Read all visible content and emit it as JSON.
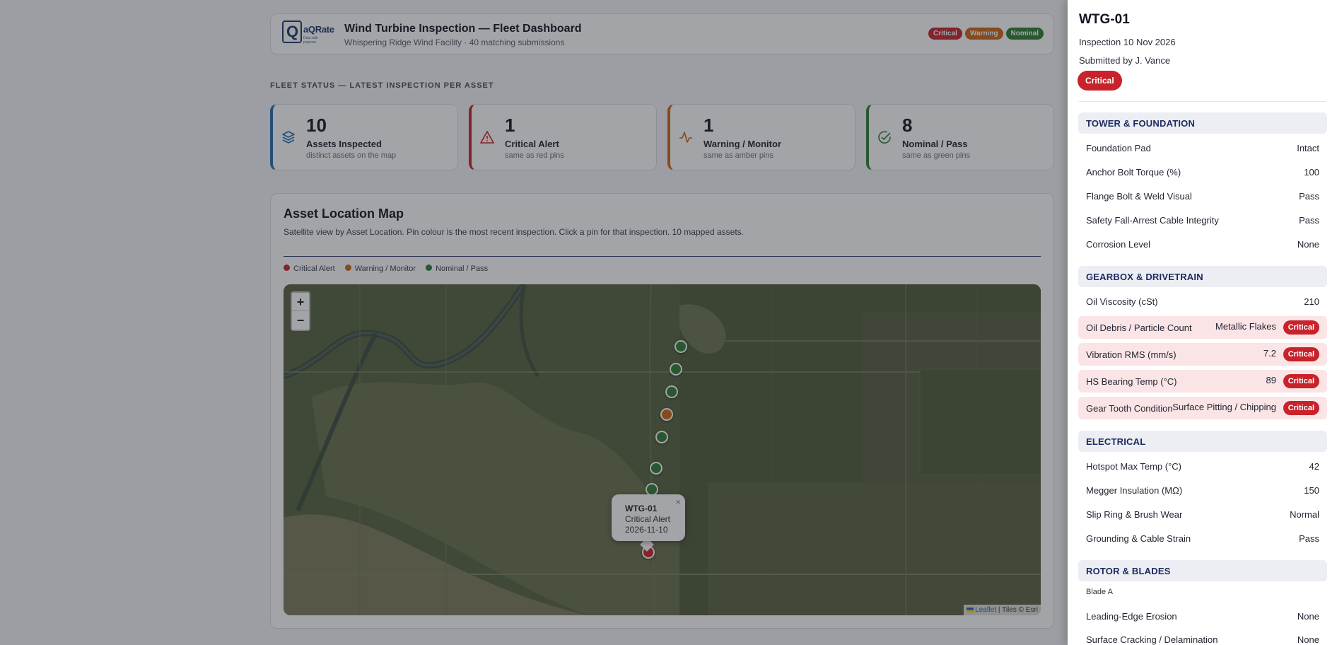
{
  "header": {
    "logo_text": "aQRate",
    "logo_q": "Q",
    "logo_tagline": "Data with purpose",
    "title": "Wind Turbine Inspection — Fleet Dashboard",
    "subtitle": "Whispering Ridge Wind Facility · 40 matching submissions",
    "pills": [
      {
        "label": "Critical",
        "color": "#c8222a"
      },
      {
        "label": "Warning",
        "color": "#cc6414"
      },
      {
        "label": "Nominal",
        "color": "#2e7d32"
      }
    ]
  },
  "section_label": "FLEET STATUS — LATEST INSPECTION PER ASSET",
  "kpis": [
    {
      "number": "10",
      "label": "Assets Inspected",
      "desc": "distinct assets on the map",
      "color": "#1f6fb2",
      "icon": "layers-icon"
    },
    {
      "number": "1",
      "label": "Critical Alert",
      "desc": "same as red pins",
      "color": "#c8222a",
      "icon": "alert-triangle-icon"
    },
    {
      "number": "1",
      "label": "Warning / Monitor",
      "desc": "same as amber pins",
      "color": "#cc6414",
      "icon": "activity-icon"
    },
    {
      "number": "8",
      "label": "Nominal / Pass",
      "desc": "same as green pins",
      "color": "#2e7d32",
      "icon": "check-circle-icon"
    }
  ],
  "map": {
    "title": "Asset Location Map",
    "description": "Satellite view by Asset Location. Pin colour is the most recent inspection. Click a pin for that inspection. 10 mapped assets.",
    "legend": [
      {
        "label": "Critical Alert",
        "color": "#c8222a"
      },
      {
        "label": "Warning / Monitor",
        "color": "#cc6414"
      },
      {
        "label": "Nominal / Pass",
        "color": "#2e7d32"
      }
    ],
    "zoom_in": "+",
    "zoom_out": "−",
    "popup": {
      "title": "WTG-01",
      "status": "Critical Alert",
      "date": "2026-11-10",
      "close": "×"
    },
    "attribution_link": "Leaflet",
    "attribution_rest": "| Tiles © Esri"
  },
  "drawer": {
    "title": "WTG-01",
    "inspection": "Inspection 10 Nov 2026",
    "submitted": "Submitted by J. Vance",
    "badge": "Critical",
    "critical_label": "Critical",
    "sections": {
      "tower": "TOWER & FOUNDATION",
      "gearbox": "GEARBOX & DRIVETRAIN",
      "electrical": "ELECTRICAL",
      "rotor": "ROTOR & BLADES"
    },
    "tower_rows": [
      {
        "label": "Foundation Pad",
        "value": "Intact"
      },
      {
        "label": "Anchor Bolt Torque (%)",
        "value": "100"
      },
      {
        "label": "Flange Bolt & Weld Visual",
        "value": "Pass"
      },
      {
        "label": "Safety Fall-Arrest Cable Integrity",
        "value": "Pass"
      },
      {
        "label": "Corrosion Level",
        "value": "None"
      }
    ],
    "gearbox_rows": [
      {
        "label": "Oil Viscosity (cSt)",
        "value": "210"
      },
      {
        "label": "Oil Debris / Particle Count",
        "value": "Metallic Flakes"
      },
      {
        "label": "Vibration RMS (mm/s)",
        "value": "7.2"
      },
      {
        "label": "HS Bearing Temp (°C)",
        "value": "89"
      },
      {
        "label": "Gear Tooth Condition",
        "value": "Surface Pitting / Chipping"
      }
    ],
    "electrical_rows": [
      {
        "label": "Hotspot Max Temp (°C)",
        "value": "42"
      },
      {
        "label": "Megger Insulation (MΩ)",
        "value": "150"
      },
      {
        "label": "Slip Ring & Brush Wear",
        "value": "Normal"
      },
      {
        "label": "Grounding & Cable Strain",
        "value": "Pass"
      }
    ],
    "rotor_subhead": "Blade A",
    "rotor_rows": [
      {
        "label": "Leading-Edge Erosion",
        "value": "None"
      },
      {
        "label": "Surface Cracking / Delamination",
        "value": "None"
      }
    ]
  }
}
